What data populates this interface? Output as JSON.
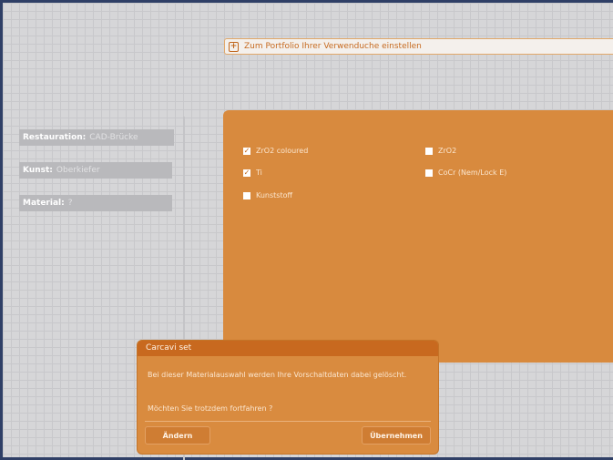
{
  "top_bar": {
    "label": "Zum Portfolio Ihrer Verwenduche einstellen"
  },
  "filters": [
    {
      "label": "Restauration:",
      "value": "CAD-Brücke"
    },
    {
      "label": "Kunst:",
      "value": "Oberkiefer"
    },
    {
      "label": "Material:",
      "value": "?"
    }
  ],
  "materials": {
    "left": [
      {
        "label": "ZrO2 coloured",
        "checked": true
      },
      {
        "label": "Ti",
        "checked": true
      },
      {
        "label": "Kunststoff",
        "checked": false
      }
    ],
    "right": [
      {
        "label": "ZrO2",
        "checked": false
      },
      {
        "label": "CoCr (Nem/Lock E)",
        "checked": false
      }
    ]
  },
  "dialog": {
    "title": "Carcavi set",
    "message": "Bei dieser Materialauswahl werden Ihre Vorschaltdaten dabei gelöscht.",
    "question": "Möchten Sie trotzdem fortfahren ?",
    "cancel_label": "Ändern",
    "confirm_label": "Übernehmen"
  },
  "colors": {
    "panel": "#d88a3e",
    "dialog_title": "#c8691f",
    "accent": "#c66a20"
  }
}
